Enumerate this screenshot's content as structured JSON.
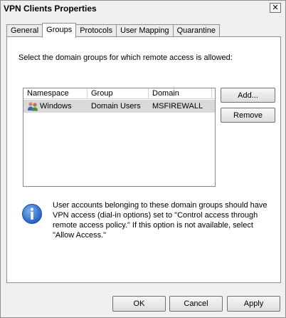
{
  "window": {
    "title": "VPN Clients Properties"
  },
  "tabs": [
    {
      "label": "General",
      "active": false
    },
    {
      "label": "Groups",
      "active": true
    },
    {
      "label": "Protocols",
      "active": false
    },
    {
      "label": "User Mapping",
      "active": false
    },
    {
      "label": "Quarantine",
      "active": false
    }
  ],
  "groups": {
    "instruction": "Select the domain groups for which remote access is allowed:",
    "columns": [
      "Namespace",
      "Group",
      "Domain"
    ],
    "rows": [
      {
        "icon": "users-group-icon",
        "namespace": "Windows",
        "group": "Domain Users",
        "domain": "MSFIREWALL",
        "selected": true
      }
    ],
    "add_label": "Add...",
    "remove_label": "Remove",
    "info_icon": "info-icon",
    "info_text": "User accounts belonging to these domain groups should have VPN access (dial-in options) set to \"Control access through remote access policy.\" If this option is not available, select \"Allow Access.\""
  },
  "footer": {
    "ok_label": "OK",
    "cancel_label": "Cancel",
    "apply_label": "Apply"
  },
  "colors": {
    "info_blue": "#2a6fc9",
    "selected_row": "#d9d9d9"
  }
}
